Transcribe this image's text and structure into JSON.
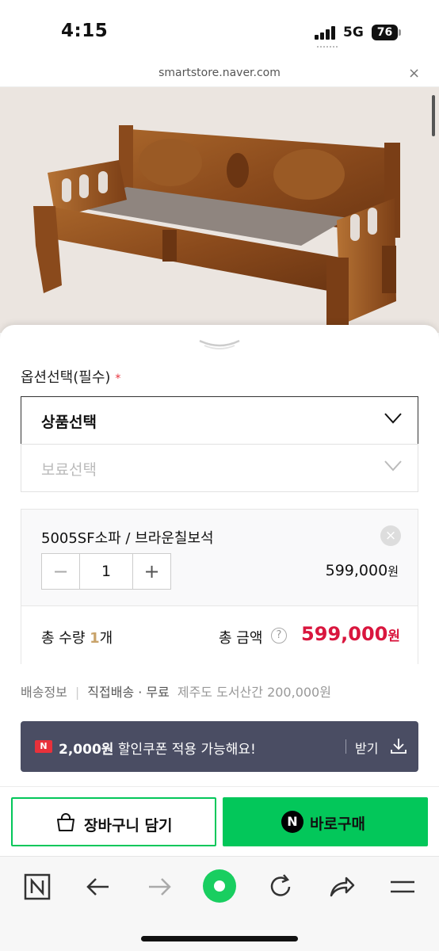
{
  "status_bar": {
    "time": "4:15",
    "network": "5G",
    "battery": "76"
  },
  "browser": {
    "url": "smartstore.naver.com",
    "close_label": "×"
  },
  "options": {
    "title": "옵션선택(필수)",
    "required_mark": "*",
    "select_product": {
      "label": "상품선택",
      "icon": "chevron-down-icon"
    },
    "select_finish": {
      "label": "보료선택",
      "icon": "chevron-down-icon"
    }
  },
  "selected_item": {
    "name": "5005SF소파 / 브라운칠보석",
    "remove_label": "×",
    "minus_label": "−",
    "quantity": "1",
    "plus_label": "+",
    "price": "599,000",
    "price_unit": "원"
  },
  "total": {
    "qty_label": "총 수량",
    "qty_value": "1",
    "qty_unit": "개",
    "amount_label": "총 금액",
    "help_label": "?",
    "amount_value": "599,000",
    "amount_unit": "원"
  },
  "shipping": {
    "label": "배송정보",
    "method": "직접배송 · 무료",
    "extra": "제주도 도서산간 200,000원"
  },
  "coupon": {
    "badge": "N",
    "amount": "2,000원",
    "text": " 할인쿠폰 적용 가능해요!",
    "receive_label": "받기"
  },
  "actions": {
    "cart_label": "장바구니 담기",
    "buy_badge": "N",
    "buy_label": "바로구매"
  },
  "colors": {
    "naver_green": "#03c75a",
    "price_red": "#d9163e",
    "coupon_bg": "#4a4d63"
  }
}
